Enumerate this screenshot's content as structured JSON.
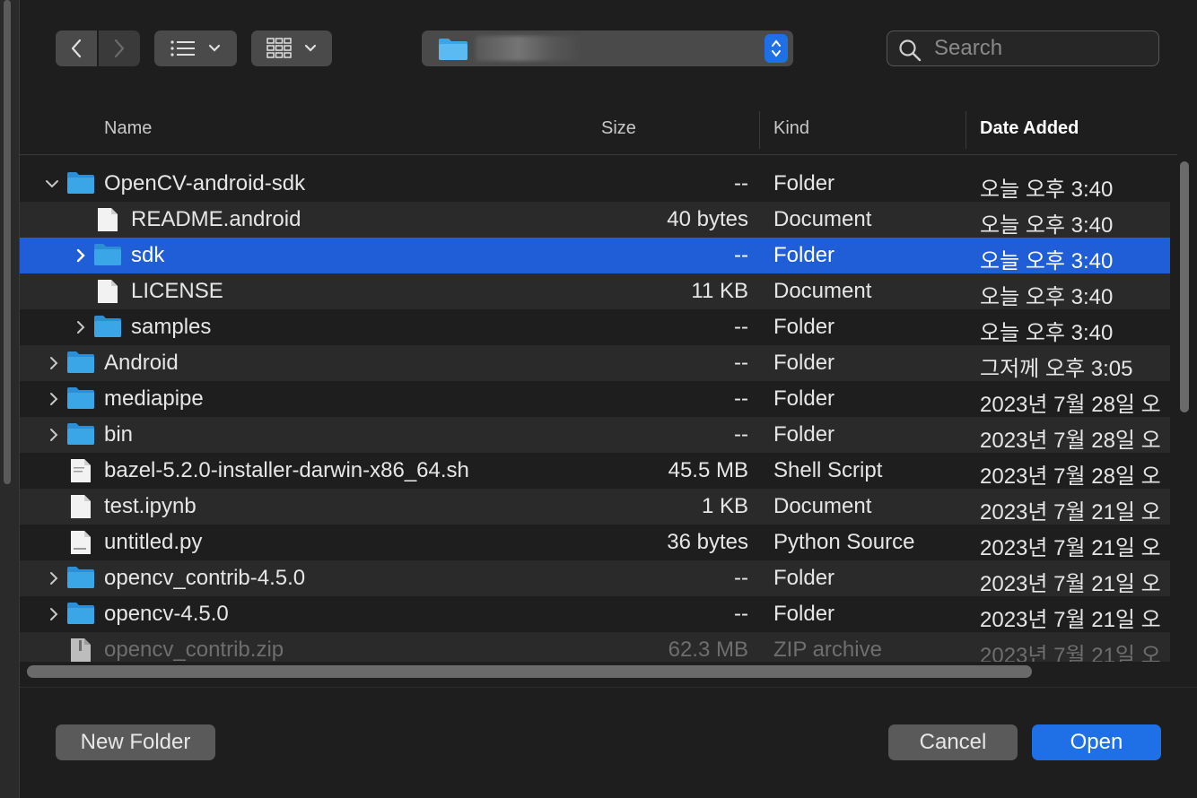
{
  "toolbar": {
    "location_label": "",
    "search_placeholder": "Search"
  },
  "columns": {
    "name": "Name",
    "size": "Size",
    "kind": "Kind",
    "date_added": "Date Added"
  },
  "files": [
    {
      "name": "OpenCV-android-sdk",
      "size": "--",
      "kind": "Folder",
      "date": "오늘 오후 3:40"
    },
    {
      "name": "README.android",
      "size": "40 bytes",
      "kind": "Document",
      "date": "오늘 오후 3:40"
    },
    {
      "name": "sdk",
      "size": "--",
      "kind": "Folder",
      "date": "오늘 오후 3:40"
    },
    {
      "name": "LICENSE",
      "size": "11 KB",
      "kind": "Document",
      "date": "오늘 오후 3:40"
    },
    {
      "name": "samples",
      "size": "--",
      "kind": "Folder",
      "date": "오늘 오후 3:40"
    },
    {
      "name": "Android",
      "size": "--",
      "kind": "Folder",
      "date": "그저께 오후 3:05"
    },
    {
      "name": "mediapipe",
      "size": "--",
      "kind": "Folder",
      "date": "2023년 7월 28일 오"
    },
    {
      "name": "bin",
      "size": "--",
      "kind": "Folder",
      "date": "2023년 7월 28일 오"
    },
    {
      "name": "bazel-5.2.0-installer-darwin-x86_64.sh",
      "size": "45.5 MB",
      "kind": "Shell Script",
      "date": "2023년 7월 28일 오"
    },
    {
      "name": "test.ipynb",
      "size": "1 KB",
      "kind": "Document",
      "date": "2023년 7월 21일 오"
    },
    {
      "name": "untitled.py",
      "size": "36 bytes",
      "kind": "Python Source",
      "date": "2023년 7월 21일 오"
    },
    {
      "name": "opencv_contrib-4.5.0",
      "size": "--",
      "kind": "Folder",
      "date": "2023년 7월 21일 오"
    },
    {
      "name": "opencv-4.5.0",
      "size": "--",
      "kind": "Folder",
      "date": "2023년 7월 21일 오"
    },
    {
      "name": "opencv_contrib.zip",
      "size": "62.3 MB",
      "kind": "ZIP archive",
      "date": "2023년 7월 21일 오"
    }
  ],
  "buttons": {
    "new_folder": "New Folder",
    "cancel": "Cancel",
    "open": "Open"
  },
  "colors": {
    "accent": "#1f6fe6",
    "selection": "#1f5ed6",
    "folder": "#3aa6e8"
  },
  "icons": {
    "back": "chevron-left-icon",
    "forward": "chevron-right-icon",
    "list_view": "list-view-icon",
    "grid_view": "grid-view-icon",
    "search": "search-icon",
    "folder": "folder-icon",
    "document": "document-icon"
  }
}
